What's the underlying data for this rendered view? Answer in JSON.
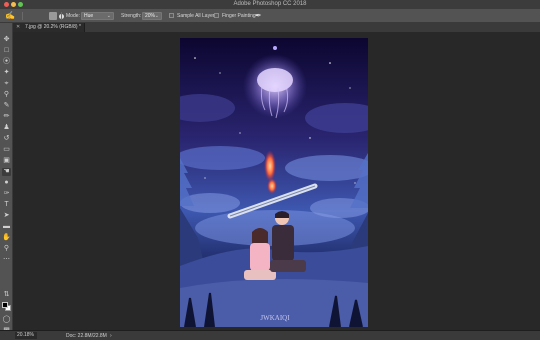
{
  "window": {
    "title": "Adobe Photoshop CC 2018"
  },
  "options_bar": {
    "mode_label": "Mode:",
    "mode_value": "Hue",
    "strength_label": "Strength:",
    "strength_value": "20%",
    "sample_all_layers_label": "Sample All Layers",
    "sample_all_layers_checked": false,
    "finger_painting_label": "Finger Painting",
    "finger_painting_checked": false
  },
  "document_tab": {
    "name": "7.jpg @ 20.2% (RGB/8) *"
  },
  "tools": [
    "move-icon",
    "marquee-icon",
    "lasso-icon",
    "quick-select-icon",
    "crop-icon",
    "eyedropper-icon",
    "healing-brush-icon",
    "brush-icon",
    "clone-stamp-icon",
    "history-brush-icon",
    "eraser-icon",
    "gradient-icon",
    "smudge-icon",
    "dodge-icon",
    "pen-icon",
    "type-icon",
    "path-select-icon",
    "rectangle-icon",
    "hand-icon",
    "zoom-icon",
    "more-tools-icon"
  ],
  "active_tool": "smudge-icon",
  "colors": {
    "foreground": "#000000",
    "background": "#ffffff",
    "ui_dark": "#282828",
    "ui_panel": "#535353"
  },
  "artwork": {
    "signature": "JWKAIQI"
  },
  "status_bar": {
    "zoom": "20.18%",
    "doc_info": "Doc: 22.8M/22.8M"
  }
}
